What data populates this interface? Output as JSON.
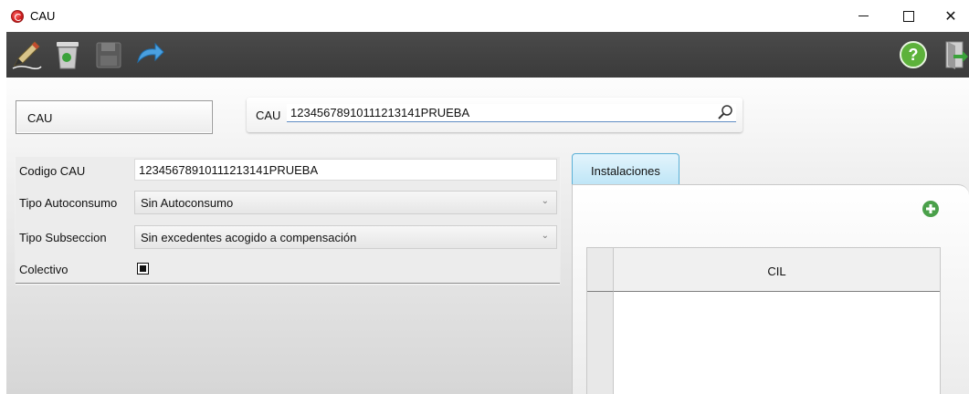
{
  "window": {
    "title": "CAU",
    "minimize": "—",
    "maximize": "☐",
    "close": "✕"
  },
  "toolbar": {
    "icons": [
      "pencil-edit-icon",
      "recycle-bin-icon",
      "floppy-save-icon",
      "undo-arrow-icon",
      "help-icon",
      "exit-door-icon"
    ]
  },
  "header": {
    "entity_label": "CAU",
    "search_label": "CAU",
    "search_value": "1234567891011121314​1PRUEBA"
  },
  "form": {
    "codigo_label": "Codigo CAU",
    "codigo_value": "12345678910111213141PRUEBA",
    "tipo_autoconsumo_label": "Tipo Autoconsumo",
    "tipo_autoconsumo_value": "Sin Autoconsumo",
    "tipo_subseccion_label": "Tipo Subseccion",
    "tipo_subseccion_value": "Sin excedentes acogido a compensación",
    "colectivo_label": "Colectivo",
    "colectivo_checked": true
  },
  "tabs": [
    {
      "label": "Instalaciones",
      "active": true
    }
  ],
  "grid": {
    "columns": [
      "CIL"
    ]
  },
  "colors": {
    "toolbar": "#404040",
    "tab_active": "#c6e9f8",
    "accent_green": "#3aa23a"
  }
}
